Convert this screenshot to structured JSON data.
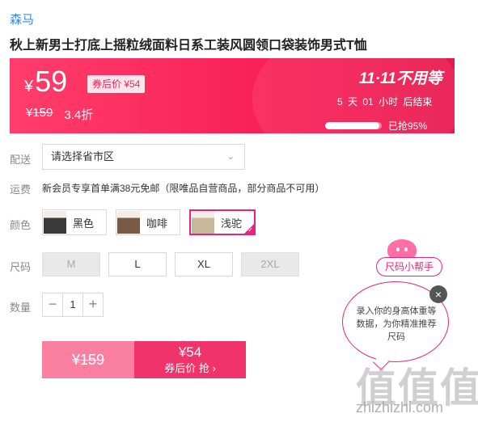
{
  "product": {
    "brand": "森马",
    "title": "秋上新男士打底上摇粒绒面料日系工装风圆领口袋装饰男式T恤"
  },
  "price": {
    "currency": "¥",
    "current": "59",
    "coupon_price": "券后价 ¥54",
    "original": "¥159",
    "discount": "3.4折",
    "promo_title": "11·11不用等",
    "countdown": "5 天 01 小时 后结束",
    "progress_percent": 95,
    "progress_label": "已抢95%",
    "accent_color": "#f81f55"
  },
  "delivery": {
    "label": "配送",
    "placeholder": "请选择省市区"
  },
  "shipping": {
    "label": "运费",
    "text": "新会员专享首单满38元免邮（限唯品自营商品，部分商品不可用）"
  },
  "colors": {
    "label": "颜色",
    "options": [
      {
        "name": "黑色",
        "selected": false,
        "swatch": "#3a3a3a"
      },
      {
        "name": "咖啡",
        "selected": false,
        "swatch": "#7a5a43"
      },
      {
        "name": "浅驼",
        "selected": true,
        "swatch": "#c9b79c"
      }
    ],
    "selected_color": "#e8237f"
  },
  "sizes": {
    "label": "尺码",
    "options": [
      {
        "name": "M",
        "disabled": true
      },
      {
        "name": "L",
        "disabled": false
      },
      {
        "name": "XL",
        "disabled": false
      },
      {
        "name": "2XL",
        "disabled": true
      }
    ]
  },
  "quantity": {
    "label": "数量",
    "minus": "−",
    "value": "1",
    "plus": "+"
  },
  "buy": {
    "original_price": "¥159",
    "coupon_price": "¥54",
    "coupon_action": "券后价 抢 ›"
  },
  "size_helper": {
    "button_label": "尺码小帮手",
    "tip": "录入你的身高体重等数据，为你精准推荐尺码",
    "close_icon": "×"
  },
  "watermark": {
    "mark": "值值值",
    "site": "zhizhizhi.com"
  }
}
